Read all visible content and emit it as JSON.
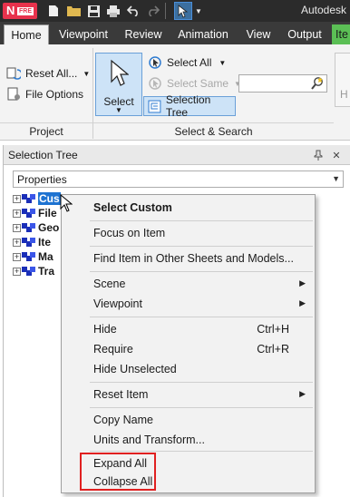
{
  "titlebar": {
    "app_letter": "N",
    "app_sub": "FRE",
    "title": "Autodesk"
  },
  "tabs": [
    "Home",
    "Viewpoint",
    "Review",
    "Animation",
    "View",
    "Output",
    "Ite"
  ],
  "ribbon": {
    "project": {
      "reset_all": "Reset All...",
      "file_options": "File Options",
      "label": "Project"
    },
    "select_search": {
      "select": "Select",
      "select_all": "Select All",
      "select_same": "Select Same",
      "selection_tree": "Selection Tree",
      "label": "Select & Search",
      "search_value": ""
    },
    "right_letter": "H"
  },
  "pane": {
    "title": "Selection Tree",
    "dropdown_value": "Properties",
    "tree_items": [
      "Cus",
      "File",
      "Geo",
      "Ite",
      "Ma",
      "Tra"
    ]
  },
  "context_menu": {
    "items": [
      {
        "label": "Select Custom",
        "bold": true
      },
      {
        "label": "Focus on Item"
      },
      {
        "label": "Find Item in Other Sheets and Models..."
      },
      {
        "label": "Scene"
      },
      {
        "label": "Viewpoint"
      },
      {
        "label": "Hide",
        "shortcut": "Ctrl+H"
      },
      {
        "label": "Require",
        "shortcut": "Ctrl+R"
      },
      {
        "label": "Hide Unselected"
      },
      {
        "label": "Reset Item"
      },
      {
        "label": "Copy Name"
      },
      {
        "label": "Units and Transform..."
      },
      {
        "label": "Expand All"
      },
      {
        "label": "Collapse All"
      }
    ]
  },
  "colors": {
    "titlebar": "#2b2b2b",
    "tabbar": "#3a3a3a",
    "accent": "#1e73d1",
    "highlight_box": "#e02020",
    "app_badge": "#e8324c"
  }
}
